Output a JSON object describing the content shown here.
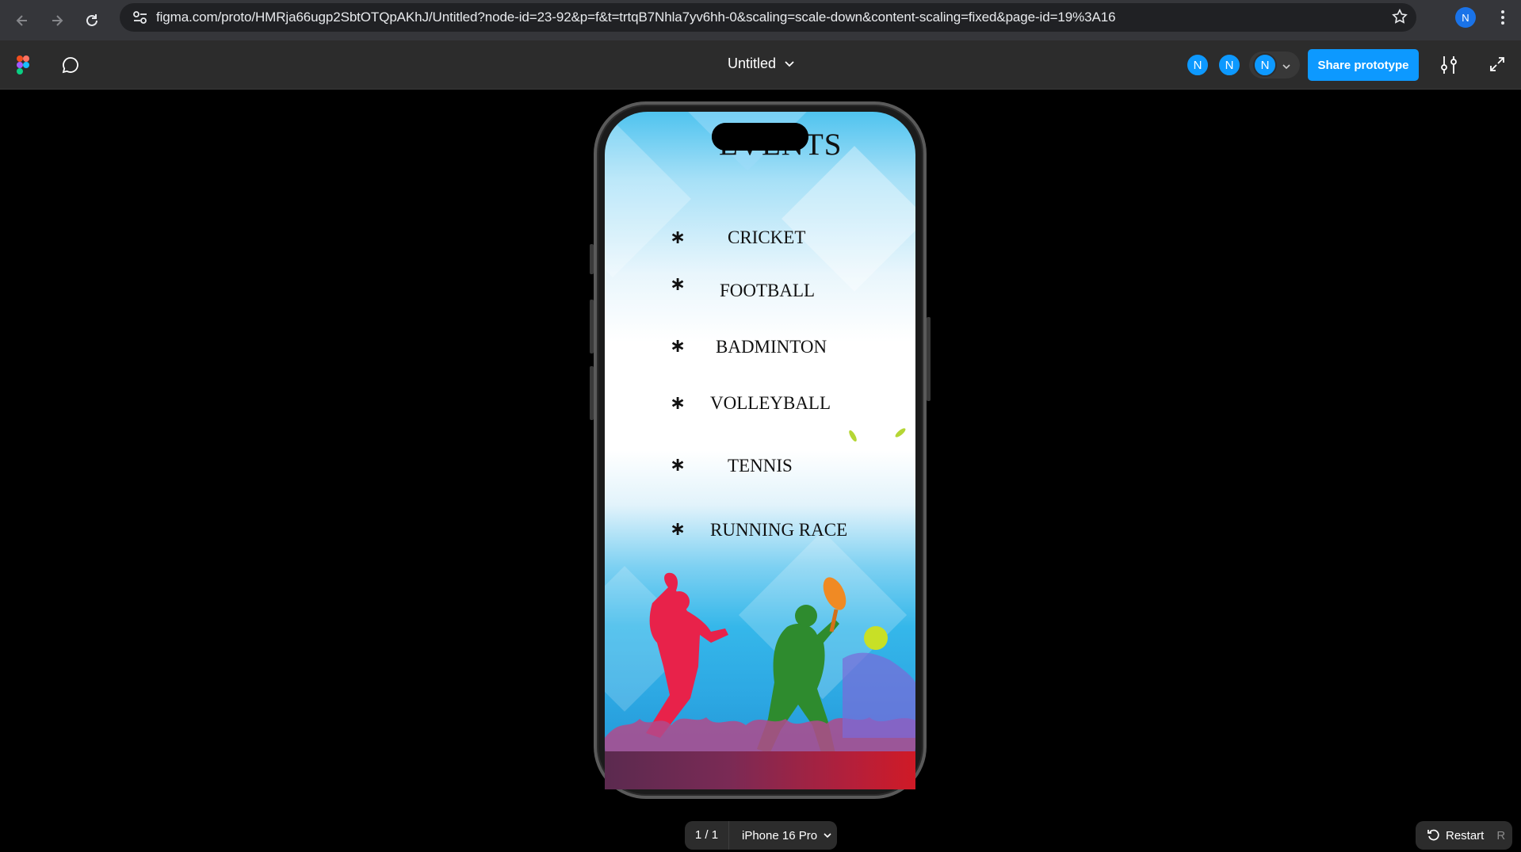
{
  "browser": {
    "url": "figma.com/proto/HMRja66ugp2SbtOTQpAKhJ/Untitled?node-id=23-92&p=f&t=trtqB7Nhla7yv6hh-0&scaling=scale-down&content-scaling=fixed&page-id=19%3A16",
    "profile_initial": "N"
  },
  "toolbar": {
    "file_title": "Untitled",
    "avatars": [
      "N",
      "N",
      "N"
    ],
    "share_label": "Share prototype"
  },
  "screen": {
    "title": "EVENTS",
    "bullet": "∗",
    "events": [
      "CRICKET",
      "FOOTBALL",
      "BADMINTON",
      "VOLLEYBALL",
      "TENNIS",
      "RUNNING RACE"
    ]
  },
  "footer": {
    "page_count": "1 / 1",
    "device": "iPhone 16 Pro",
    "restart_label": "Restart",
    "restart_key": "R"
  },
  "colors": {
    "accent": "#0d99ff",
    "toolbar_bg": "#2c2c2c",
    "browser_bg": "#35363a"
  }
}
